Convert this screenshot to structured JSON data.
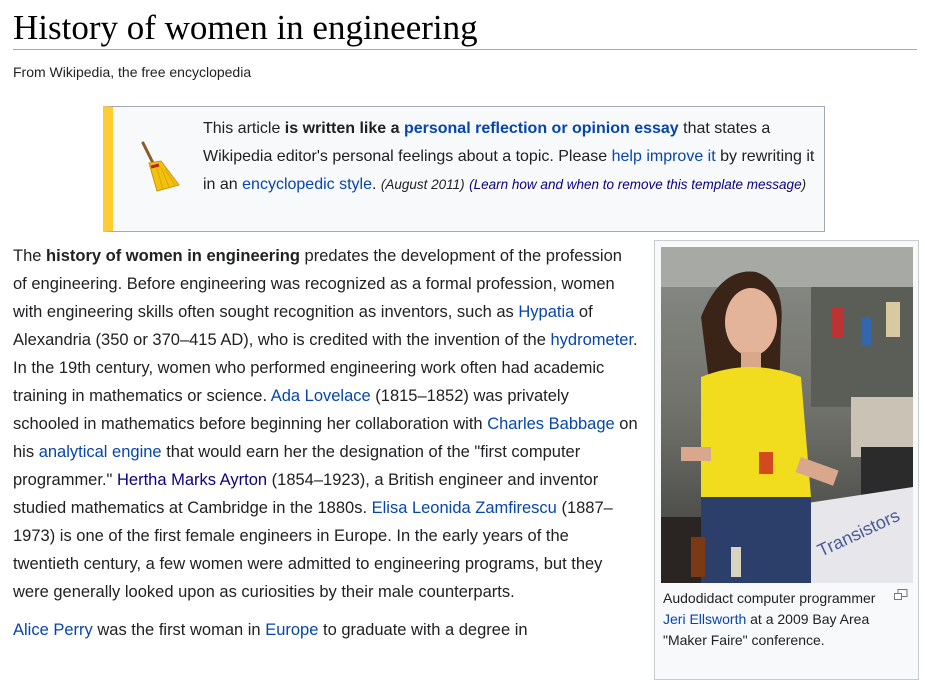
{
  "article": {
    "title": "History of women in engineering",
    "tagline": "From Wikipedia, the free encyclopedia"
  },
  "notice": {
    "t1": "This article ",
    "t2": "is written like a ",
    "link1": "personal reflection or opinion essay",
    "t3": " that states a Wikipedia editor's personal feelings about a topic. Please ",
    "link2": "help improve it",
    "t4": " by rewriting it in an ",
    "link3": "encyclopedic style",
    "t5": ". ",
    "date": "(August 2011)",
    "link4_prefix": "(",
    "link4": "Learn how and when to remove this template message",
    "link4_suffix": ")",
    "icon": "broom-icon",
    "accent_color": "#ffcc33"
  },
  "body": {
    "p1": {
      "s1": "The ",
      "bold": "history of women in engineering",
      "s2": " predates the development of the profession of engineering. Before engineering was recognized as a formal profession, women with engineering skills often sought recognition as inventors, such as ",
      "l_hypatia": "Hypatia",
      "s3": " of Alexandria (350 or 370–415 AD), who is credited with the invention of the ",
      "l_hydrometer": "hydrometer",
      "s4": ". In the 19th century, women who performed engineering work often had academic training in mathematics or science. ",
      "l_ada": "Ada Lovelace",
      "s5": " (1815–1852) was privately schooled in mathematics before beginning her collaboration with ",
      "l_babbage": "Charles Babbage",
      "s6": " on his ",
      "l_engine": "analytical engine",
      "s7": " that would earn her the designation of the \"first computer programmer.\" ",
      "l_hertha": "Hertha Marks Ayrton",
      "s8": " (1854–1923), a British engineer and inventor studied mathematics at Cambridge in the 1880s. ",
      "l_elisa": "Elisa Leonida Zamfirescu",
      "s9": " (1887–1973) is one of the first female engineers in Europe. In the early years of the twentieth century, a few women were admitted to engineering programs, but they were generally looked upon as curiosities by their male counterparts."
    },
    "p2": {
      "l_alice": "Alice Perry",
      "s1": " was the first woman in ",
      "l_europe": "Europe",
      "s2": " to graduate with a degree in"
    }
  },
  "infobox": {
    "caption_pre": "Audodidact computer programmer ",
    "caption_link": "Jeri Ellsworth",
    "caption_post": " at a 2009 Bay Area \"Maker Faire\" conference.",
    "enlarge_icon": "enlarge-icon"
  }
}
